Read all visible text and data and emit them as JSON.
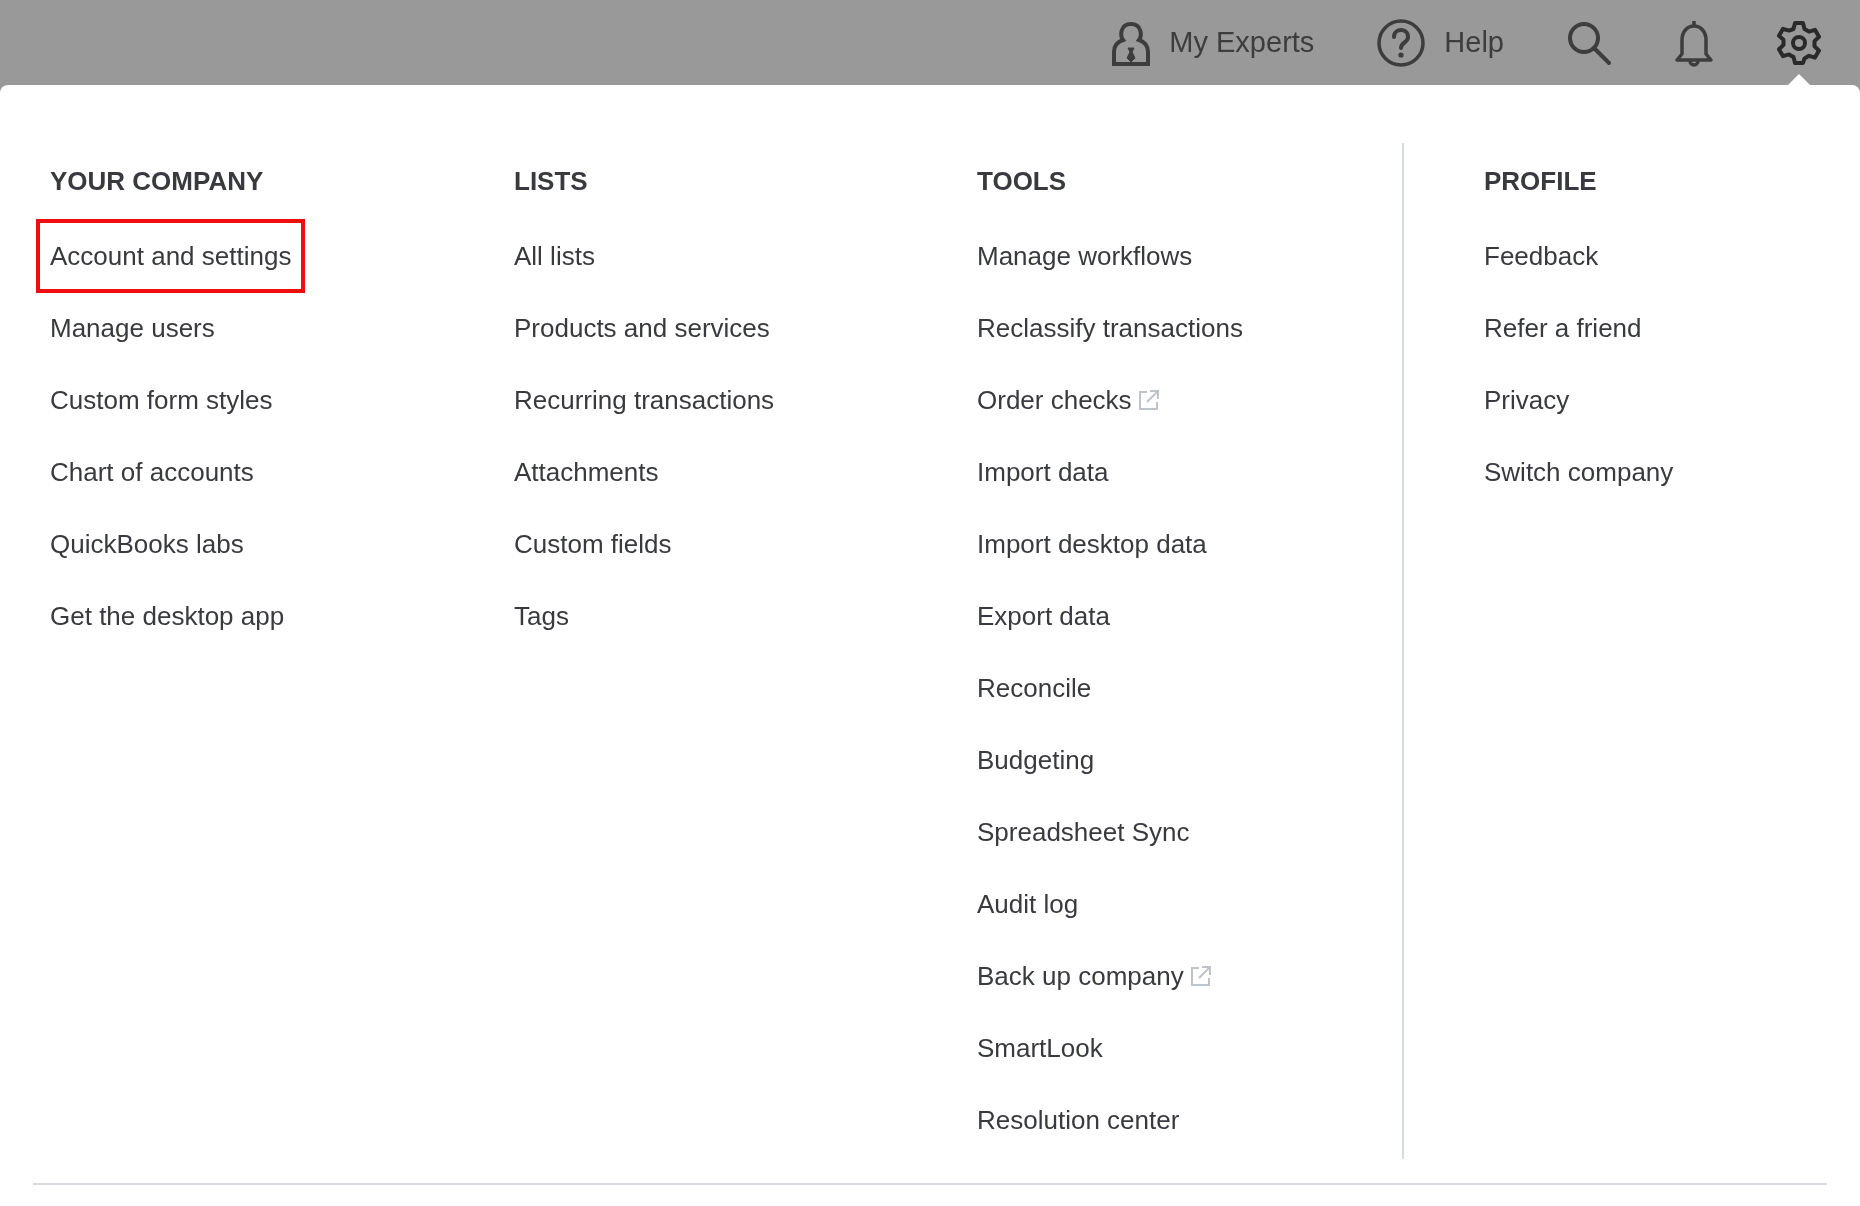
{
  "top_bar": {
    "items": [
      {
        "kind": "experts",
        "label": "My Experts",
        "selected": false
      },
      {
        "kind": "help",
        "label": "Help",
        "selected": false
      },
      {
        "kind": "search",
        "selected": false
      },
      {
        "kind": "notifications",
        "selected": false
      },
      {
        "kind": "settings",
        "selected": true
      }
    ]
  },
  "menu": {
    "sections": [
      {
        "title": "YOUR COMPANY",
        "items": [
          {
            "label": "Account and settings",
            "external": false,
            "highlighted": true
          },
          {
            "label": "Manage users",
            "external": false,
            "highlighted": false
          },
          {
            "label": "Custom form styles",
            "external": false,
            "highlighted": false
          },
          {
            "label": "Chart of accounts",
            "external": false,
            "highlighted": false
          },
          {
            "label": "QuickBooks labs",
            "external": false,
            "highlighted": false
          },
          {
            "label": "Get the desktop app",
            "external": false,
            "highlighted": false
          }
        ]
      },
      {
        "title": "LISTS",
        "items": [
          {
            "label": "All lists",
            "external": false,
            "highlighted": false
          },
          {
            "label": "Products and services",
            "external": false,
            "highlighted": false
          },
          {
            "label": "Recurring transactions",
            "external": false,
            "highlighted": false
          },
          {
            "label": "Attachments",
            "external": false,
            "highlighted": false
          },
          {
            "label": "Custom fields",
            "external": false,
            "highlighted": false
          },
          {
            "label": "Tags",
            "external": false,
            "highlighted": false
          }
        ]
      },
      {
        "title": "TOOLS",
        "items": [
          {
            "label": "Manage workflows",
            "external": false,
            "highlighted": false
          },
          {
            "label": "Reclassify transactions",
            "external": false,
            "highlighted": false
          },
          {
            "label": "Order checks",
            "external": true,
            "highlighted": false
          },
          {
            "label": "Import data",
            "external": false,
            "highlighted": false
          },
          {
            "label": "Import desktop data",
            "external": false,
            "highlighted": false
          },
          {
            "label": "Export data",
            "external": false,
            "highlighted": false
          },
          {
            "label": "Reconcile",
            "external": false,
            "highlighted": false
          },
          {
            "label": "Budgeting",
            "external": false,
            "highlighted": false
          },
          {
            "label": "Spreadsheet Sync",
            "external": false,
            "highlighted": false
          },
          {
            "label": "Audit log",
            "external": false,
            "highlighted": false
          },
          {
            "label": "Back up company",
            "external": true,
            "highlighted": false
          },
          {
            "label": "SmartLook",
            "external": false,
            "highlighted": false
          },
          {
            "label": "Resolution center",
            "external": false,
            "highlighted": false
          }
        ]
      },
      {
        "title": "PROFILE",
        "items": [
          {
            "label": "Feedback",
            "external": false,
            "highlighted": false
          },
          {
            "label": "Refer a friend",
            "external": false,
            "highlighted": false
          },
          {
            "label": "Privacy",
            "external": false,
            "highlighted": false
          },
          {
            "label": "Switch company",
            "external": false,
            "highlighted": false
          }
        ]
      }
    ]
  }
}
